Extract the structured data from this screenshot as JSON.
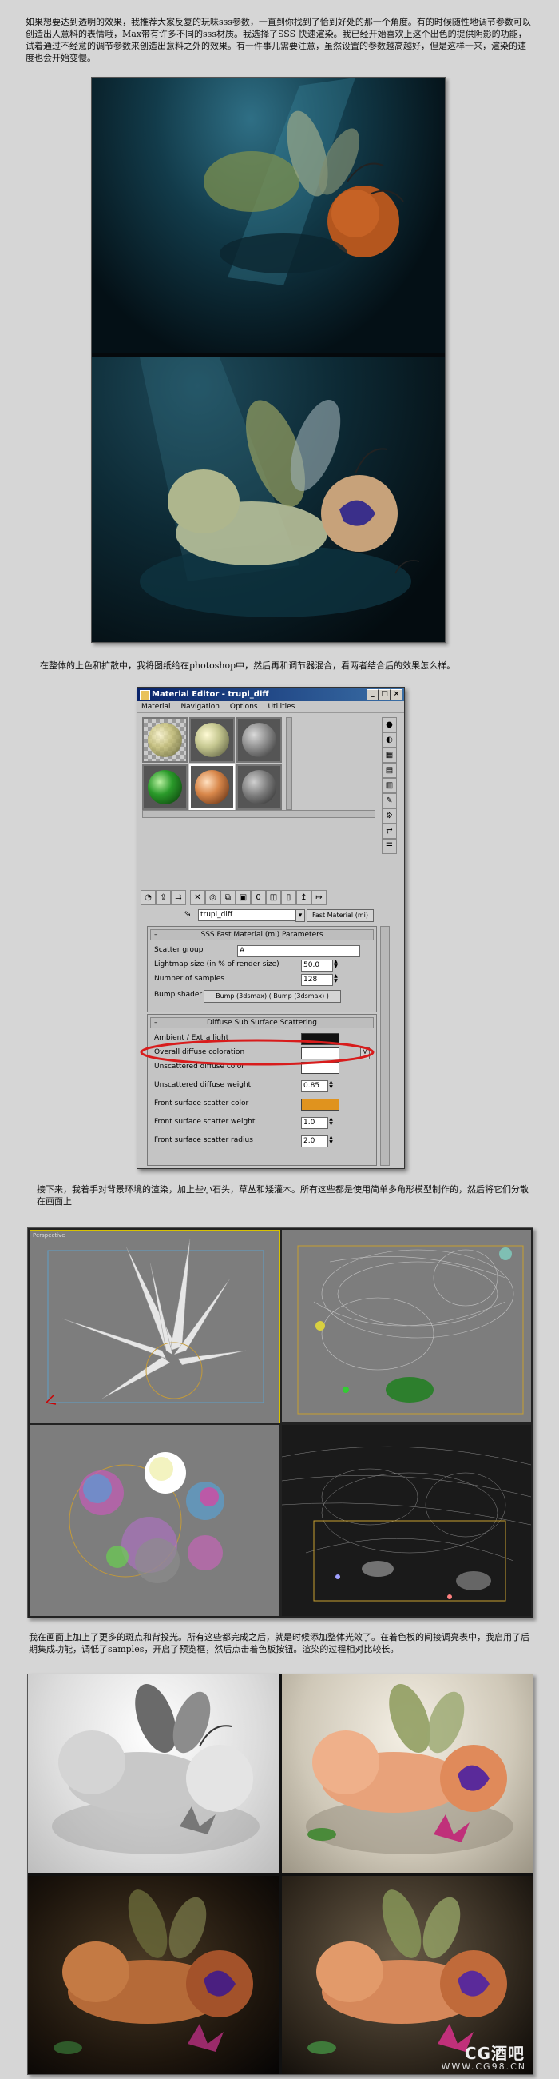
{
  "intro_text": "如果想要达到透明的效果，我推荐大家反复的玩味sss参数，一直到你找到了恰到好处的那一个角度。有的时候随性地调节参数可以创造出人意料的表情哦，Max带有许多不同的sss材质。我选择了SSS 快速渲染。我已经开始喜欢上这个出色的提供阴影的功能，试着通过不经意的调节参数来创造出意料之外的效果。有一件事儿需要注意，虽然设置的参数越高越好，但是这样一来，渲染的速度也会开始变慢。",
  "mid_text": "在整体的上色和扩散中，我将图纸给在photoshop中，然后再和调节器混合，看两者结合后的效果怎么样。",
  "material_editor": {
    "title": "Material Editor - trupi_diff",
    "menu": [
      "Material",
      "Navigation",
      "Options",
      "Utilities"
    ],
    "material_name": "trupi_diff",
    "material_type": "Fast Material (mi)",
    "rollout1": {
      "title": "SSS Fast Material (mi) Parameters",
      "scatter_group_label": "Scatter group",
      "scatter_group_value": "A",
      "lightmap_label": "Lightmap size (in % of render size)",
      "lightmap_value": "50.0",
      "samples_label": "Number of samples",
      "samples_value": "128",
      "bump_label": "Bump shader",
      "bump_value": "Bump (3dsmax)  ( Bump (3dsmax) )"
    },
    "rollout2": {
      "title": "Diffuse Sub Surface Scattering",
      "params": [
        {
          "label": "Ambient / Extra light",
          "swatch": "#111111"
        },
        {
          "label": "Overall diffuse coloration",
          "swatch": "#ffffff",
          "map": "M"
        },
        {
          "label": "Unscattered diffuse color",
          "swatch": "#ffffff"
        },
        {
          "label": "Unscattered diffuse weight",
          "value": "0.85"
        },
        {
          "label": "Front surface scatter color",
          "swatch": "#e0931e"
        },
        {
          "label": "Front surface scatter weight",
          "value": "1.0"
        },
        {
          "label": "Front surface scatter radius",
          "value": "2.0"
        }
      ]
    }
  },
  "scene_text": "接下来，我着手对背景环境的渲染，加上些小石头，草丛和矮灌木。所有这些都是使用简单多角形模型制作的，然后将它们分散在画面上",
  "viewport_label": "Perspective",
  "final_text": "我在画面上加上了更多的斑点和背投光。所有这些都完成之后，就是时候添加整体光效了。在着色板的间接调亮表中，我启用了后期集成功能，调低了samples，开启了预览框，然后点击着色板按钮。渲染的过程相对比较长。",
  "watermark": {
    "brand": "CG酒吧",
    "url": "WWW.CG98.CN"
  }
}
